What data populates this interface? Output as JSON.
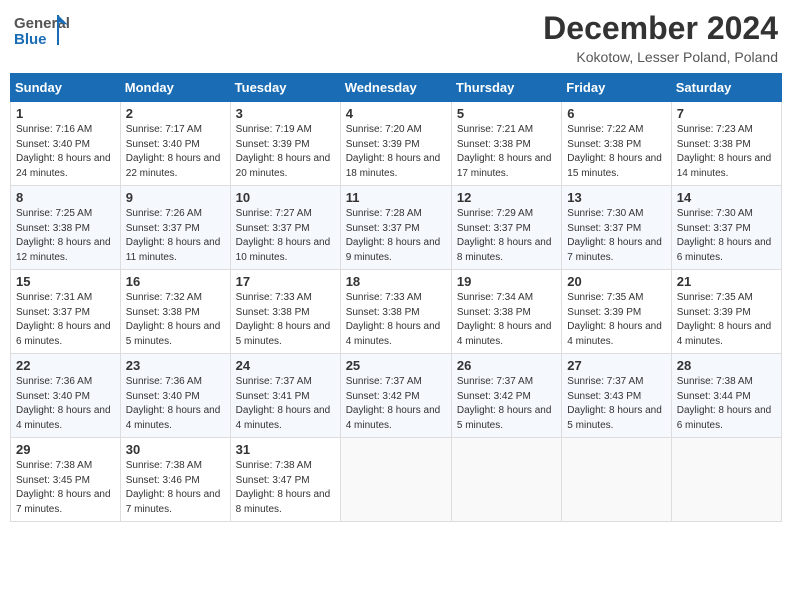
{
  "header": {
    "logo_general": "General",
    "logo_blue": "Blue",
    "title": "December 2024",
    "location": "Kokotow, Lesser Poland, Poland"
  },
  "days_of_week": [
    "Sunday",
    "Monday",
    "Tuesday",
    "Wednesday",
    "Thursday",
    "Friday",
    "Saturday"
  ],
  "weeks": [
    [
      {
        "day": 1,
        "sunrise": "Sunrise: 7:16 AM",
        "sunset": "Sunset: 3:40 PM",
        "daylight": "Daylight: 8 hours and 24 minutes."
      },
      {
        "day": 2,
        "sunrise": "Sunrise: 7:17 AM",
        "sunset": "Sunset: 3:40 PM",
        "daylight": "Daylight: 8 hours and 22 minutes."
      },
      {
        "day": 3,
        "sunrise": "Sunrise: 7:19 AM",
        "sunset": "Sunset: 3:39 PM",
        "daylight": "Daylight: 8 hours and 20 minutes."
      },
      {
        "day": 4,
        "sunrise": "Sunrise: 7:20 AM",
        "sunset": "Sunset: 3:39 PM",
        "daylight": "Daylight: 8 hours and 18 minutes."
      },
      {
        "day": 5,
        "sunrise": "Sunrise: 7:21 AM",
        "sunset": "Sunset: 3:38 PM",
        "daylight": "Daylight: 8 hours and 17 minutes."
      },
      {
        "day": 6,
        "sunrise": "Sunrise: 7:22 AM",
        "sunset": "Sunset: 3:38 PM",
        "daylight": "Daylight: 8 hours and 15 minutes."
      },
      {
        "day": 7,
        "sunrise": "Sunrise: 7:23 AM",
        "sunset": "Sunset: 3:38 PM",
        "daylight": "Daylight: 8 hours and 14 minutes."
      }
    ],
    [
      {
        "day": 8,
        "sunrise": "Sunrise: 7:25 AM",
        "sunset": "Sunset: 3:38 PM",
        "daylight": "Daylight: 8 hours and 12 minutes."
      },
      {
        "day": 9,
        "sunrise": "Sunrise: 7:26 AM",
        "sunset": "Sunset: 3:37 PM",
        "daylight": "Daylight: 8 hours and 11 minutes."
      },
      {
        "day": 10,
        "sunrise": "Sunrise: 7:27 AM",
        "sunset": "Sunset: 3:37 PM",
        "daylight": "Daylight: 8 hours and 10 minutes."
      },
      {
        "day": 11,
        "sunrise": "Sunrise: 7:28 AM",
        "sunset": "Sunset: 3:37 PM",
        "daylight": "Daylight: 8 hours and 9 minutes."
      },
      {
        "day": 12,
        "sunrise": "Sunrise: 7:29 AM",
        "sunset": "Sunset: 3:37 PM",
        "daylight": "Daylight: 8 hours and 8 minutes."
      },
      {
        "day": 13,
        "sunrise": "Sunrise: 7:30 AM",
        "sunset": "Sunset: 3:37 PM",
        "daylight": "Daylight: 8 hours and 7 minutes."
      },
      {
        "day": 14,
        "sunrise": "Sunrise: 7:30 AM",
        "sunset": "Sunset: 3:37 PM",
        "daylight": "Daylight: 8 hours and 6 minutes."
      }
    ],
    [
      {
        "day": 15,
        "sunrise": "Sunrise: 7:31 AM",
        "sunset": "Sunset: 3:37 PM",
        "daylight": "Daylight: 8 hours and 6 minutes."
      },
      {
        "day": 16,
        "sunrise": "Sunrise: 7:32 AM",
        "sunset": "Sunset: 3:38 PM",
        "daylight": "Daylight: 8 hours and 5 minutes."
      },
      {
        "day": 17,
        "sunrise": "Sunrise: 7:33 AM",
        "sunset": "Sunset: 3:38 PM",
        "daylight": "Daylight: 8 hours and 5 minutes."
      },
      {
        "day": 18,
        "sunrise": "Sunrise: 7:33 AM",
        "sunset": "Sunset: 3:38 PM",
        "daylight": "Daylight: 8 hours and 4 minutes."
      },
      {
        "day": 19,
        "sunrise": "Sunrise: 7:34 AM",
        "sunset": "Sunset: 3:38 PM",
        "daylight": "Daylight: 8 hours and 4 minutes."
      },
      {
        "day": 20,
        "sunrise": "Sunrise: 7:35 AM",
        "sunset": "Sunset: 3:39 PM",
        "daylight": "Daylight: 8 hours and 4 minutes."
      },
      {
        "day": 21,
        "sunrise": "Sunrise: 7:35 AM",
        "sunset": "Sunset: 3:39 PM",
        "daylight": "Daylight: 8 hours and 4 minutes."
      }
    ],
    [
      {
        "day": 22,
        "sunrise": "Sunrise: 7:36 AM",
        "sunset": "Sunset: 3:40 PM",
        "daylight": "Daylight: 8 hours and 4 minutes."
      },
      {
        "day": 23,
        "sunrise": "Sunrise: 7:36 AM",
        "sunset": "Sunset: 3:40 PM",
        "daylight": "Daylight: 8 hours and 4 minutes."
      },
      {
        "day": 24,
        "sunrise": "Sunrise: 7:37 AM",
        "sunset": "Sunset: 3:41 PM",
        "daylight": "Daylight: 8 hours and 4 minutes."
      },
      {
        "day": 25,
        "sunrise": "Sunrise: 7:37 AM",
        "sunset": "Sunset: 3:42 PM",
        "daylight": "Daylight: 8 hours and 4 minutes."
      },
      {
        "day": 26,
        "sunrise": "Sunrise: 7:37 AM",
        "sunset": "Sunset: 3:42 PM",
        "daylight": "Daylight: 8 hours and 5 minutes."
      },
      {
        "day": 27,
        "sunrise": "Sunrise: 7:37 AM",
        "sunset": "Sunset: 3:43 PM",
        "daylight": "Daylight: 8 hours and 5 minutes."
      },
      {
        "day": 28,
        "sunrise": "Sunrise: 7:38 AM",
        "sunset": "Sunset: 3:44 PM",
        "daylight": "Daylight: 8 hours and 6 minutes."
      }
    ],
    [
      {
        "day": 29,
        "sunrise": "Sunrise: 7:38 AM",
        "sunset": "Sunset: 3:45 PM",
        "daylight": "Daylight: 8 hours and 7 minutes."
      },
      {
        "day": 30,
        "sunrise": "Sunrise: 7:38 AM",
        "sunset": "Sunset: 3:46 PM",
        "daylight": "Daylight: 8 hours and 7 minutes."
      },
      {
        "day": 31,
        "sunrise": "Sunrise: 7:38 AM",
        "sunset": "Sunset: 3:47 PM",
        "daylight": "Daylight: 8 hours and 8 minutes."
      },
      null,
      null,
      null,
      null
    ]
  ]
}
